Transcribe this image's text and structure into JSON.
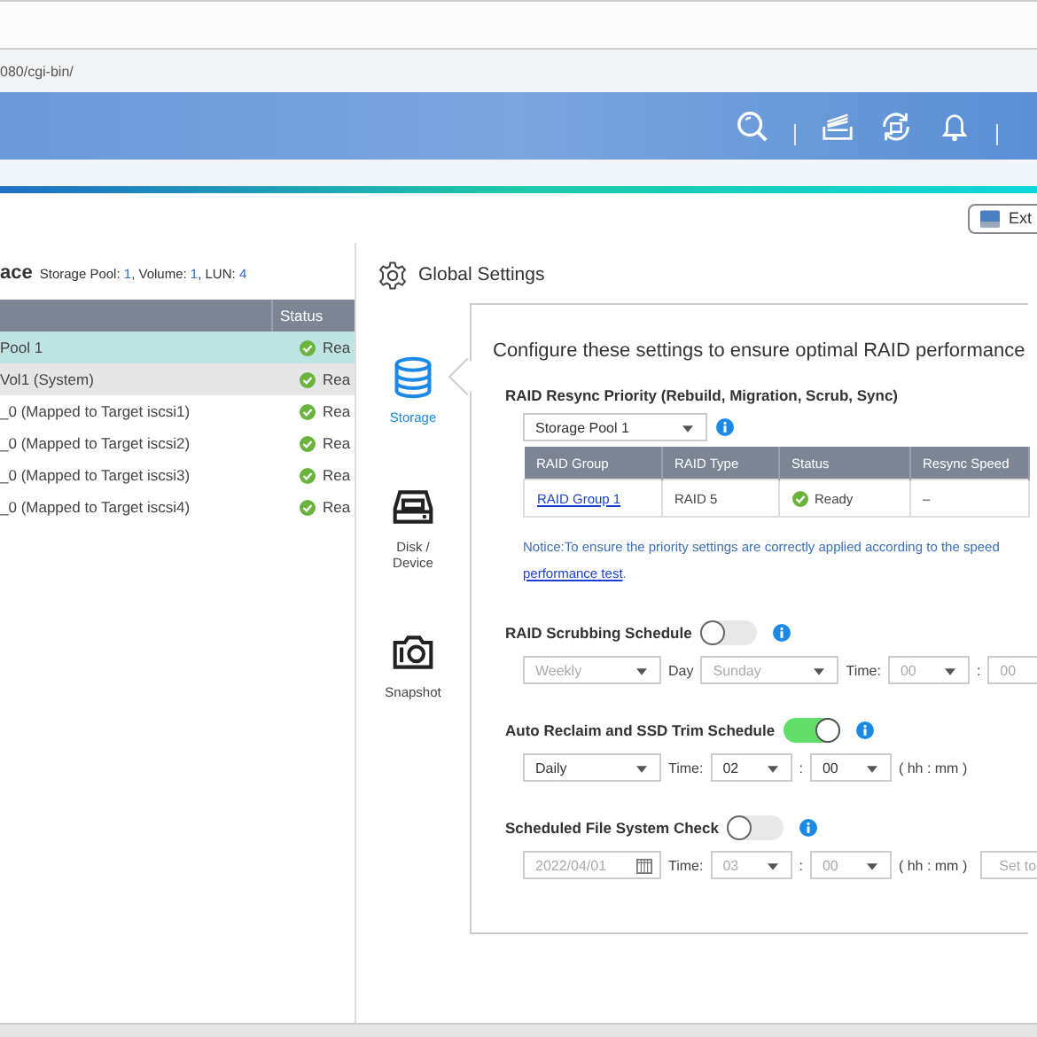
{
  "browser": {
    "url": "080/cgi-bin/"
  },
  "toolbar": {
    "button": "Ext"
  },
  "storage_panel": {
    "title": "ace",
    "summary": [
      {
        "label": "Storage Pool:",
        "value": "1"
      },
      {
        "label": ", Volume:",
        "value": "1"
      },
      {
        "label": ", LUN:",
        "value": "4"
      }
    ],
    "columns": [
      "Status"
    ],
    "rows": [
      {
        "name": "Pool 1",
        "status": "Rea",
        "selected": true,
        "highlighted": false
      },
      {
        "name": "Vol1 (System)",
        "status": "Rea",
        "selected": false,
        "highlighted": true
      },
      {
        "name": "_0 (Mapped to Target iscsi1)",
        "status": "Rea",
        "selected": false,
        "highlighted": false
      },
      {
        "name": "_0 (Mapped to Target iscsi2)",
        "status": "Rea",
        "selected": false,
        "highlighted": false
      },
      {
        "name": "_0 (Mapped to Target iscsi3)",
        "status": "Rea",
        "selected": false,
        "highlighted": false
      },
      {
        "name": "_0 (Mapped to Target iscsi4)",
        "status": "Rea",
        "selected": false,
        "highlighted": false
      }
    ]
  },
  "global_settings": {
    "title": "Global Settings",
    "nav": [
      {
        "kind": "storage",
        "label": "Storage",
        "selected": true
      },
      {
        "kind": "disk",
        "label": "Disk / Device",
        "selected": false
      },
      {
        "kind": "snapshot",
        "label": "Snapshot",
        "selected": false
      }
    ],
    "intro": "Configure these settings to ensure optimal RAID performance",
    "sections": [
      {
        "kind": "resync",
        "title": "RAID Resync Priority (Rebuild, Migration, Scrub, Sync)",
        "select": "Storage Pool 1",
        "table": {
          "columns": [
            "RAID Group",
            "RAID Type",
            "Status",
            "Resync Speed"
          ],
          "rows": [
            {
              "raid_group": "RAID Group 1",
              "raid_type": "RAID 5",
              "status": "Ready",
              "resync_speed": "–"
            }
          ]
        },
        "notice": "Notice:To ensure the priority settings are correctly applied according to the speed",
        "notice_link": "performance test",
        "notice_end": "."
      },
      {
        "kind": "schedule",
        "title": "RAID Scrubbing Schedule",
        "on": false,
        "controls": [
          {
            "kind": "select",
            "value": "Weekly"
          },
          {
            "kind": "label",
            "value": "Day"
          },
          {
            "kind": "select",
            "value": "Sunday"
          },
          {
            "kind": "label",
            "value": "Time:"
          },
          {
            "kind": "time",
            "value": "00"
          },
          {
            "kind": "label",
            "value": ":"
          },
          {
            "kind": "time-end",
            "value": "00"
          }
        ]
      },
      {
        "kind": "schedule",
        "title": "Auto Reclaim and SSD Trim Schedule",
        "on": true,
        "controls": [
          {
            "kind": "select",
            "value": "Daily"
          },
          {
            "kind": "label",
            "value": "Time:"
          },
          {
            "kind": "time",
            "value": "02"
          },
          {
            "kind": "label",
            "value": ":"
          },
          {
            "kind": "time",
            "value": "00"
          },
          {
            "kind": "label",
            "value": "( hh : mm )"
          }
        ]
      },
      {
        "kind": "schedule",
        "title": "Scheduled File System Check",
        "on": false,
        "controls": [
          {
            "kind": "date",
            "value": "2022/04/01"
          },
          {
            "kind": "label",
            "value": "Time:"
          },
          {
            "kind": "time",
            "value": "03"
          },
          {
            "kind": "label",
            "value": ":"
          },
          {
            "kind": "time",
            "value": "00"
          },
          {
            "kind": "label",
            "value": "( hh : mm )"
          },
          {
            "kind": "button",
            "value": "Set to"
          }
        ]
      }
    ]
  }
}
